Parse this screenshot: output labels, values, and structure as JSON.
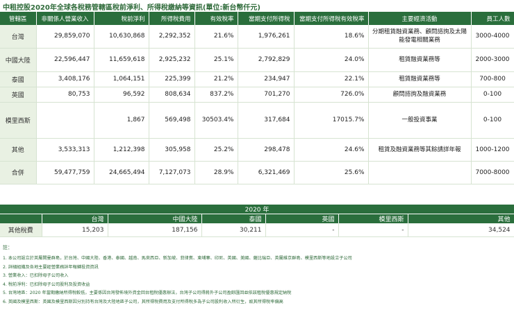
{
  "title": "中租控股2020年全球各稅務管轄區稅前淨利、所得稅繳納等資訊(單位:新台幣仟元)",
  "main_table": {
    "headers": [
      "管轄區",
      "非關係人營業收入",
      "稅前淨利",
      "所得稅費用",
      "有效稅率",
      "當期支付所得稅",
      "當期支付所得稅有效稅率",
      "主要經濟活動",
      "員工人數"
    ],
    "rows": [
      {
        "region": "台灣",
        "revenue": "29,859,070",
        "pretax": "10,630,868",
        "tax_expense": "2,292,352",
        "eff_rate": "21.6%",
        "tax_paid": "1,976,261",
        "paid_rate": "18.6%",
        "activity": "分期租賃融資業務、顧問諮詢及太陽能發電相關業務",
        "employees": "3000-4000"
      },
      {
        "region": "中國大陸",
        "revenue": "22,596,447",
        "pretax": "11,659,618",
        "tax_expense": "2,925,232",
        "eff_rate": "25.1%",
        "tax_paid": "2,792,829",
        "paid_rate": "24.0%",
        "activity": "租賃融資業務等",
        "employees": "2000-3000"
      },
      {
        "region": "泰國",
        "revenue": "3,408,176",
        "pretax": "1,064,151",
        "tax_expense": "225,399",
        "eff_rate": "21.2%",
        "tax_paid": "234,947",
        "paid_rate": "22.1%",
        "activity": "租賃融資業務等",
        "employees": "700-800"
      },
      {
        "region": "英國",
        "revenue": "80,753",
        "pretax": "96,592",
        "tax_expense": "808,634",
        "eff_rate": "837.2%",
        "tax_paid": "701,270",
        "paid_rate": "726.0%",
        "activity": "顧問諮詢及融資業務",
        "employees": "0-100"
      },
      {
        "region": "模里西斯",
        "revenue": "",
        "pretax": "1,867",
        "tax_expense": "569,498",
        "eff_rate": "30503.4%",
        "tax_paid": "317,684",
        "paid_rate": "17015.7%",
        "activity": "一般投資事業",
        "employees": "0-100"
      },
      {
        "region": "其他",
        "revenue": "3,533,313",
        "pretax": "1,212,398",
        "tax_expense": "305,958",
        "eff_rate": "25.2%",
        "tax_paid": "298,478",
        "paid_rate": "24.6%",
        "activity": "租賃及融資業務等其餘請詳年報",
        "employees": "1000-1200"
      },
      {
        "region": "合併",
        "revenue": "59,477,759",
        "pretax": "24,665,494",
        "tax_expense": "7,127,073",
        "eff_rate": "28.9%",
        "tax_paid": "6,321,469",
        "paid_rate": "25.6%",
        "activity": "",
        "employees": "7000-8000"
      }
    ]
  },
  "other_tax_table": {
    "year": "2020 年",
    "headers": [
      "",
      "台灣",
      "中國大陸",
      "泰國",
      "英國",
      "模里西斯",
      "其他"
    ],
    "label": "其他稅費",
    "values": [
      "15,203",
      "187,156",
      "30,211",
      "-",
      "-",
      "34,524"
    ]
  },
  "notes": {
    "heading": "註：",
    "items": [
      "1. 本公司設立於英屬開曼群島，於台灣、中國大陸、香港、泰國、越南、馬來西亞、新加坡、菲律賓、柬埔寨、印尼、英國、美國、薩比瑞亞、英屬維京群島、模里西斯等地設立子公司",
      "2. 詳細組織及各地主要經營業務詳年報轉投資資訊",
      "3. 營業收入：已扣除母子公司收入",
      "4. 稅前淨利：已扣除母子公司股利及投資收益",
      "5. 台灣地區：2020 年當期繳納所得稅較低，主要係因台灣發佈境外資金回台租稅優惠辦法，台灣子公司得將外子公司盈餘匯回並依該租稅優惠規定納稅",
      "6. 英國及模里西斯：英國及模里西斯因分別持有台灣及大陸地區子公司，其所得稅費用及支付所得稅多為子公司股利收入所衍生，故其所得稅率偏高"
    ]
  },
  "colors": {
    "header_green": "#2a6e3c",
    "light_green": "#e9f1e3",
    "text_green": "#2f6b3a"
  }
}
